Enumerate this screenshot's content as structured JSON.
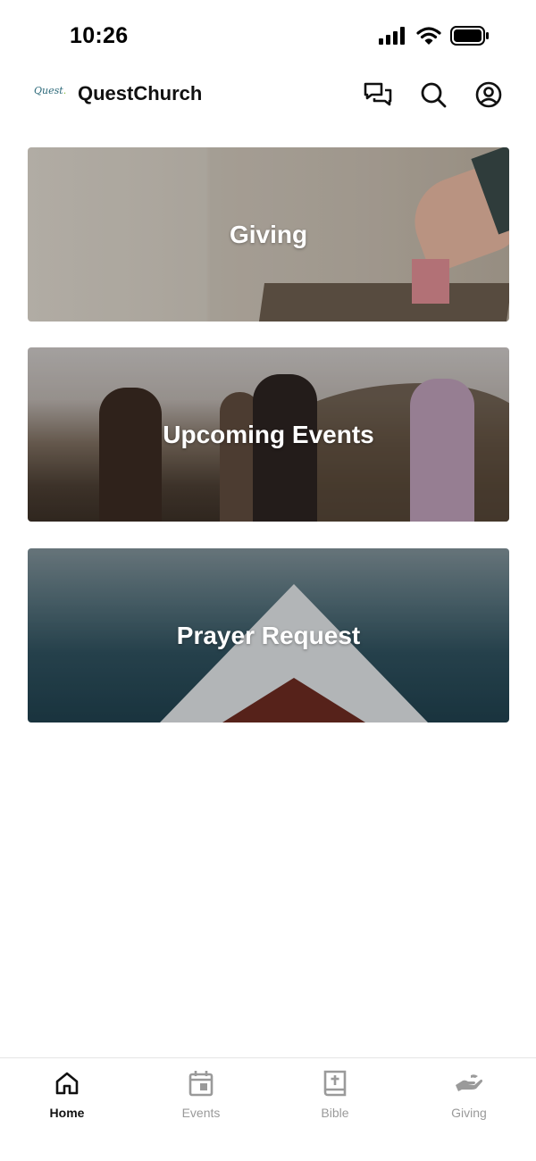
{
  "status_bar": {
    "time": "10:26"
  },
  "header": {
    "logo_text": "Quest",
    "title": "QuestChurch",
    "icons": [
      "chat-icon",
      "search-icon",
      "account-icon"
    ]
  },
  "cards": [
    {
      "label": "Giving"
    },
    {
      "label": "Upcoming Events"
    },
    {
      "label": "Prayer Request"
    }
  ],
  "tab_bar": {
    "tabs": [
      {
        "label": "Home",
        "icon": "home-icon",
        "active": true
      },
      {
        "label": "Events",
        "icon": "calendar-icon",
        "active": false
      },
      {
        "label": "Bible",
        "icon": "bible-icon",
        "active": false
      },
      {
        "label": "Giving",
        "icon": "giving-hand-icon",
        "active": false
      }
    ]
  },
  "colors": {
    "active_tab": "#111111",
    "inactive_tab": "#9a9a9a",
    "logo_teal": "#2d6a7a",
    "logo_green": "#8bbd3a"
  }
}
